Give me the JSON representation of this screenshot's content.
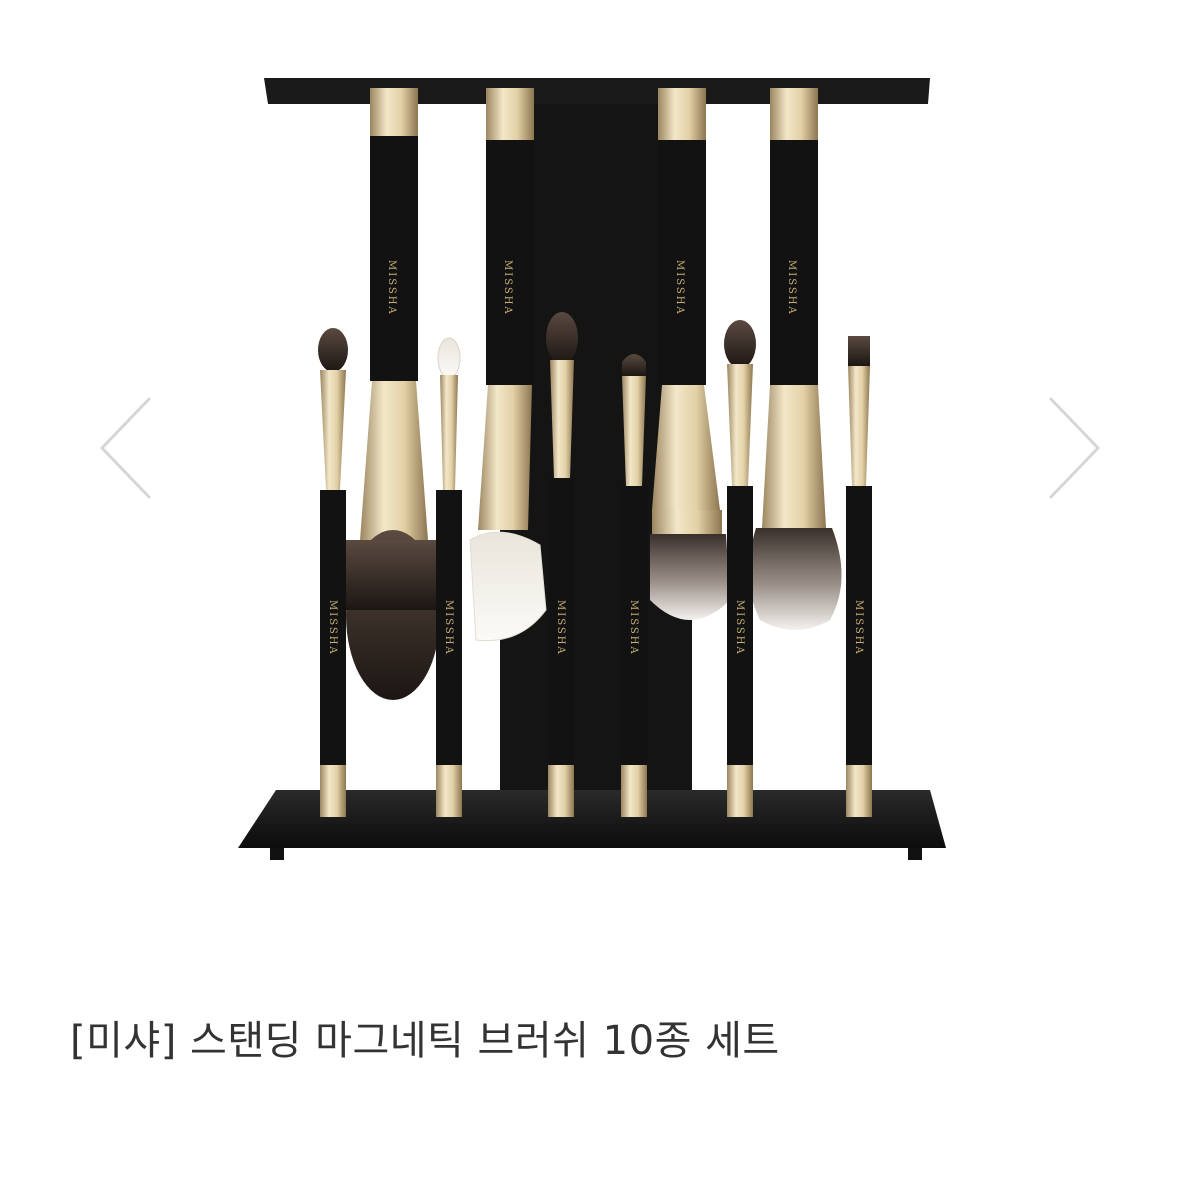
{
  "product": {
    "title": "[미샤] 스탠딩 마그네틱 브러쉬 10종 세트",
    "brand_mark": "MISSHA",
    "brush_count": 10
  },
  "carousel": {
    "prev_icon": "chevron-left-icon",
    "next_icon": "chevron-right-icon"
  },
  "colors": {
    "stand": "#1a1a1a",
    "handle": "#141414",
    "gold": "#d8c49a",
    "arrow": "#d6d6d6",
    "title_text": "#333333"
  }
}
